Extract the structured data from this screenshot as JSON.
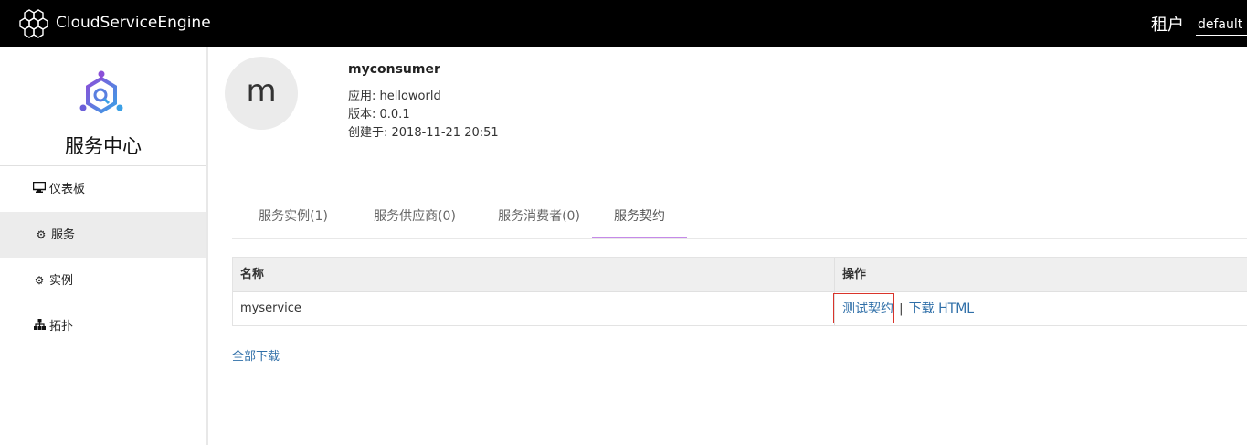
{
  "header": {
    "brand": "CloudServiceEngine",
    "tenant_label": "租户",
    "tenant_value": "default"
  },
  "sidebar": {
    "title": "服务中心",
    "items": [
      {
        "label": "仪表板",
        "icon": "monitor-icon"
      },
      {
        "label": "服务",
        "icon": "gear-icon",
        "active": true
      },
      {
        "label": "实例",
        "icon": "cogs-icon"
      },
      {
        "label": "拓扑",
        "icon": "sitemap-icon"
      }
    ]
  },
  "service": {
    "avatar_letter": "m",
    "name": "myconsumer",
    "app": "应用: helloworld",
    "version": "版本: 0.0.1",
    "created": "创建于: 2018-11-21 20:51"
  },
  "tabs": [
    {
      "label": "服务实例(1)"
    },
    {
      "label": "服务供应商(0)"
    },
    {
      "label": "服务消费者(0)"
    },
    {
      "label": "服务契约",
      "active": true
    }
  ],
  "table": {
    "headers": [
      "名称",
      "操作"
    ],
    "rows": [
      {
        "name": "myservice",
        "action_test": "测试契约",
        "separator": "|",
        "action_download": "下载 HTML"
      }
    ]
  },
  "download_all": "全部下载",
  "colors": {
    "header_bg": "#000000",
    "link": "#2f6fa8",
    "tab_underline": "#c58ae8",
    "highlight_border": "#d9342b"
  }
}
